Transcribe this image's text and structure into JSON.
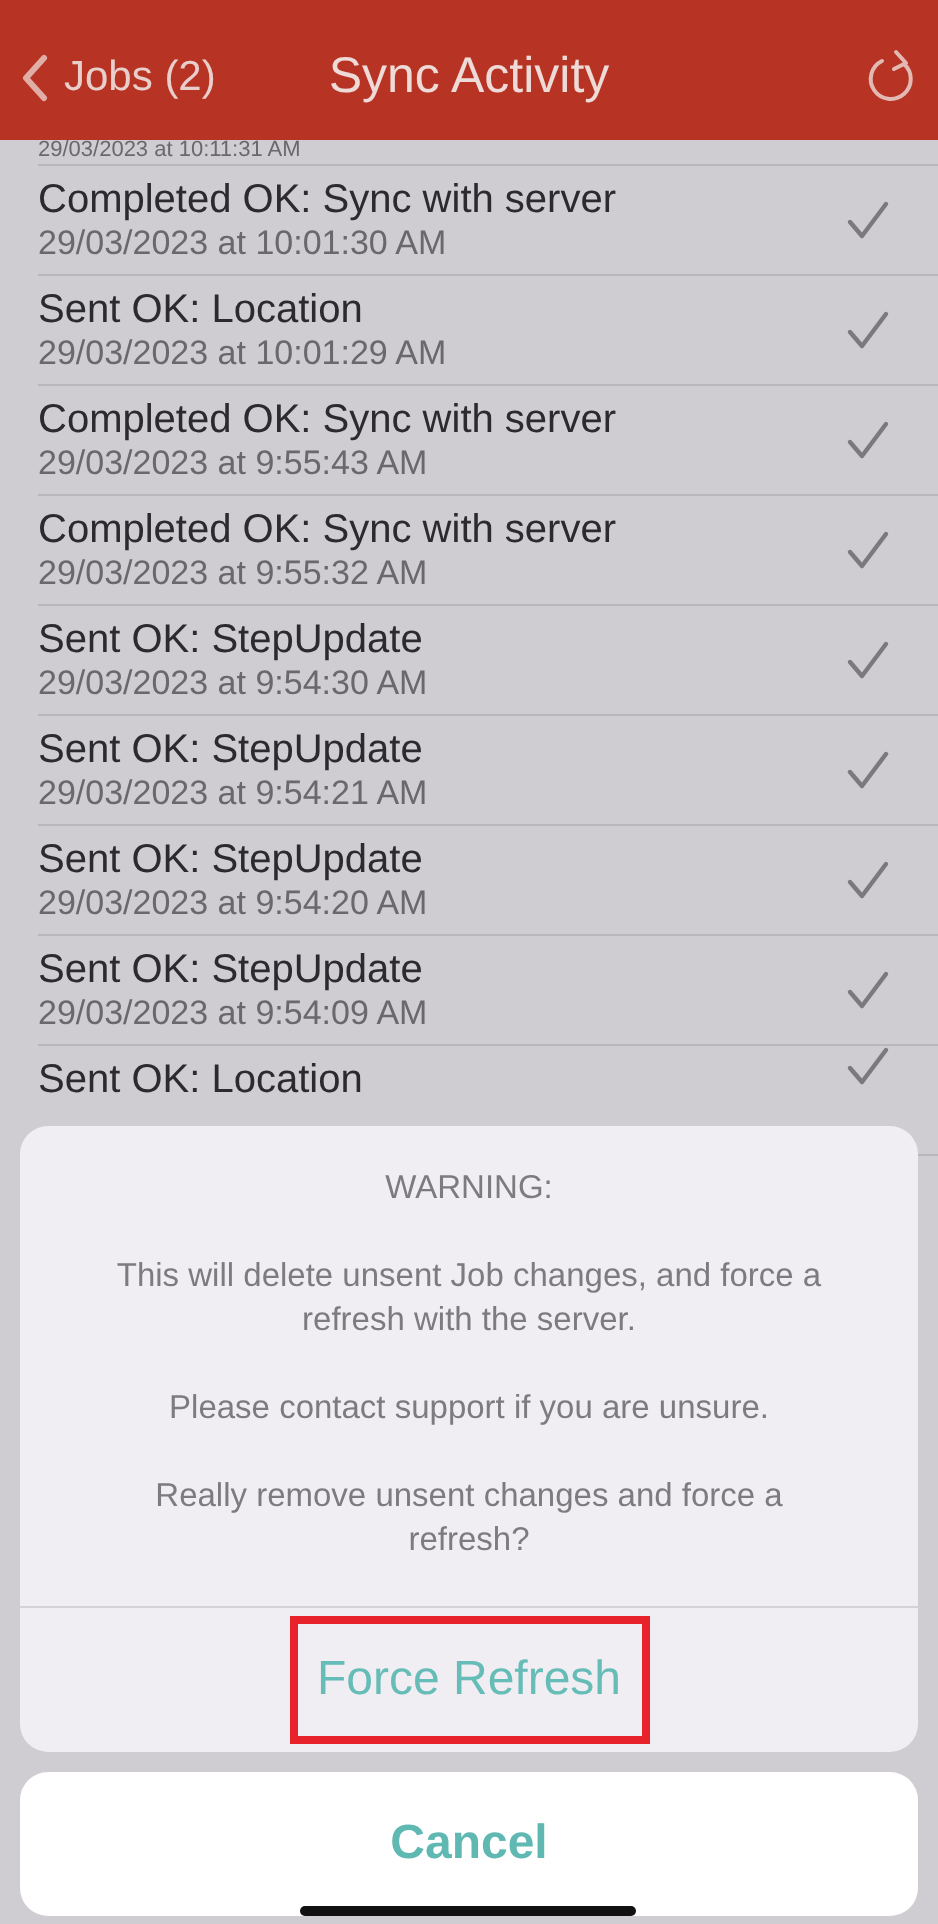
{
  "nav_bar": {
    "back_label": "Jobs (2)",
    "title": "Sync Activity"
  },
  "first_row_date": "29/03/2023 at 10:11:31 AM",
  "activities": [
    {
      "title": "Completed OK: Sync with server",
      "date": "29/03/2023 at 10:01:30 AM",
      "done": true
    },
    {
      "title": "Sent OK: Location",
      "date": "29/03/2023 at 10:01:29 AM",
      "done": true
    },
    {
      "title": "Completed OK: Sync with server",
      "date": "29/03/2023 at 9:55:43 AM",
      "done": true
    },
    {
      "title": "Completed OK: Sync with server",
      "date": "29/03/2023 at 9:55:32 AM",
      "done": true
    },
    {
      "title": "Sent OK: StepUpdate",
      "date": "29/03/2023 at 9:54:30 AM",
      "done": true
    },
    {
      "title": "Sent OK: StepUpdate",
      "date": "29/03/2023 at 9:54:21 AM",
      "done": true
    },
    {
      "title": "Sent OK: StepUpdate",
      "date": "29/03/2023 at 9:54:20 AM",
      "done": true
    },
    {
      "title": "Sent OK: StepUpdate",
      "date": "29/03/2023 at 9:54:09 AM",
      "done": true
    },
    {
      "title": "Sent OK: Location",
      "done": true
    }
  ],
  "action_sheet": {
    "messages": [
      "WARNING:",
      "This will delete unsent Job changes, and force a refresh with the server.",
      "Please contact support if you are unsure.",
      "Really remove unsent changes and force a refresh?"
    ],
    "action": {
      "label": "Force Refresh",
      "highlighted": true
    },
    "cancel": "Cancel"
  }
}
